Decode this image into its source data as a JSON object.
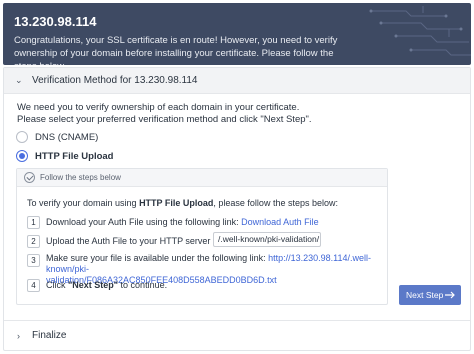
{
  "header": {
    "title": "13.230.98.114",
    "message": "Congratulations, your SSL certificate is en route! However, you need to verify ownership of your domain before installing your certificate. Please follow the steps below."
  },
  "verification": {
    "section_title": "Verification Method for 13.230.98.114",
    "intro_line1": "We need you to verify ownership of each domain in your certificate.",
    "intro_line2": "Please select your preferred verification method and click \"Next Step\".",
    "options": [
      {
        "label": "DNS (CNAME)",
        "selected": false
      },
      {
        "label": "HTTP File Upload",
        "selected": true
      }
    ]
  },
  "steps": {
    "header_label": "Follow the steps below",
    "intro_prefix": "To verify your domain using ",
    "intro_method": "HTTP File Upload",
    "intro_suffix": ", please follow the steps below:",
    "items": [
      {
        "num": "1",
        "text": "Download your Auth File using the following link: ",
        "link": "Download Auth File"
      },
      {
        "num": "2",
        "text": "Upload the Auth File to your HTTP server under:",
        "path": "/.well-known/pki-validation/"
      },
      {
        "num": "3",
        "text": "Make sure your file is available under the following link: ",
        "link_line1": "http://13.230.98.114/.well-known/pki-",
        "link_line2": "validation/F086A32AC850FEE408D558ABEDD0BD6D.txt"
      },
      {
        "num": "4",
        "text_prefix": "Click ",
        "text_bold": "\"Next Step\"",
        "text_suffix": " to continue."
      }
    ]
  },
  "next_button": {
    "label": "Next Step"
  },
  "finalize": {
    "label": "Finalize"
  },
  "colors": {
    "header_bg": "#3e4a63",
    "accent": "#4a6ee0",
    "link": "#3f66d6",
    "button": "#5b79c8"
  },
  "icons": {
    "section_toggle": "chevron-down-icon",
    "finalize_toggle": "chevron-right-icon",
    "steps_header": "check-circle-icon",
    "next_button": "arrow-right-icon"
  }
}
